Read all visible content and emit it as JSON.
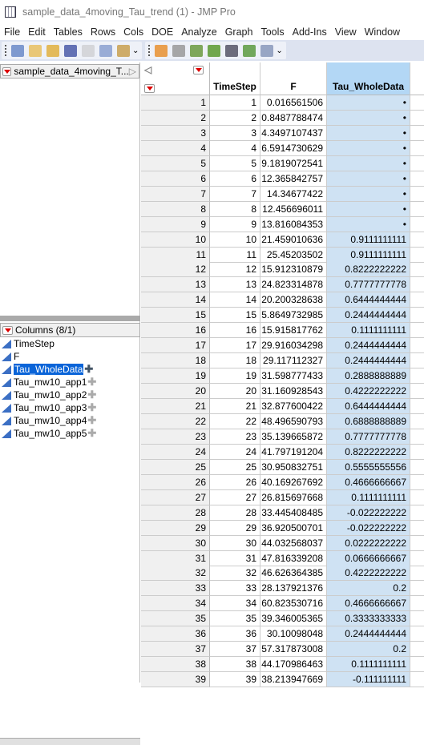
{
  "window": {
    "title": "sample_data_4moving_Tau_trend (1) - JMP Pro"
  },
  "menu": [
    "File",
    "Edit",
    "Tables",
    "Rows",
    "Cols",
    "DOE",
    "Analyze",
    "Graph",
    "Tools",
    "Add-Ins",
    "View",
    "Window"
  ],
  "toolbar": {
    "group1": [
      "new-data-table-icon",
      "new-script-icon",
      "open-icon",
      "save-icon",
      "cut-icon",
      "copy-icon",
      "paste-icon"
    ],
    "group2": [
      "data-table-icon",
      "tabulate-icon",
      "graph-builder-icon",
      "distribution-icon",
      "fit-y-by-x-icon",
      "fit-model-icon",
      "script-editor-icon"
    ]
  },
  "table_panel": {
    "title": "sample_data_4moving_T..."
  },
  "columns_panel": {
    "title": "Columns (8/1)",
    "items": [
      "TimeStep",
      "F",
      "Tau_WholeData",
      "Tau_mw10_app1",
      "Tau_mw10_app2",
      "Tau_mw10_app3",
      "Tau_mw10_app4",
      "Tau_mw10_app5"
    ],
    "selected": "Tau_WholeData"
  },
  "table": {
    "headers": [
      "TimeStep",
      "F",
      "Tau_WholeData"
    ],
    "rows": [
      [
        "1",
        "1",
        "0.016561506",
        "•"
      ],
      [
        "2",
        "2",
        "0.8487788474",
        "•"
      ],
      [
        "3",
        "3",
        "4.3497107437",
        "•"
      ],
      [
        "4",
        "4",
        "6.5914730629",
        "•"
      ],
      [
        "5",
        "5",
        "9.1819072541",
        "•"
      ],
      [
        "6",
        "6",
        "12.365842757",
        "•"
      ],
      [
        "7",
        "7",
        "14.34677422",
        "•"
      ],
      [
        "8",
        "8",
        "12.456696011",
        "•"
      ],
      [
        "9",
        "9",
        "13.816084353",
        "•"
      ],
      [
        "10",
        "10",
        "21.459010636",
        "0.9111111111"
      ],
      [
        "11",
        "11",
        "25.45203502",
        "0.9111111111"
      ],
      [
        "12",
        "12",
        "15.912310879",
        "0.8222222222"
      ],
      [
        "13",
        "13",
        "24.823314878",
        "0.7777777778"
      ],
      [
        "14",
        "14",
        "20.200328638",
        "0.6444444444"
      ],
      [
        "15",
        "15",
        "5.8649732985",
        "0.2444444444"
      ],
      [
        "16",
        "16",
        "15.915817762",
        "0.1111111111"
      ],
      [
        "17",
        "17",
        "29.916034298",
        "0.2444444444"
      ],
      [
        "18",
        "18",
        "29.117112327",
        "0.2444444444"
      ],
      [
        "19",
        "19",
        "31.598777433",
        "0.2888888889"
      ],
      [
        "20",
        "20",
        "31.160928543",
        "0.4222222222"
      ],
      [
        "21",
        "21",
        "32.877600422",
        "0.6444444444"
      ],
      [
        "22",
        "22",
        "48.496590793",
        "0.6888888889"
      ],
      [
        "23",
        "23",
        "35.139665872",
        "0.7777777778"
      ],
      [
        "24",
        "24",
        "41.797191204",
        "0.8222222222"
      ],
      [
        "25",
        "25",
        "30.950832751",
        "0.5555555556"
      ],
      [
        "26",
        "26",
        "40.169267692",
        "0.4666666667"
      ],
      [
        "27",
        "27",
        "26.815697668",
        "0.1111111111"
      ],
      [
        "28",
        "28",
        "33.445408485",
        "-0.022222222"
      ],
      [
        "29",
        "29",
        "36.920500701",
        "-0.022222222"
      ],
      [
        "30",
        "30",
        "44.032568037",
        "0.0222222222"
      ],
      [
        "31",
        "31",
        "47.816339208",
        "0.0666666667"
      ],
      [
        "32",
        "32",
        "46.626364385",
        "0.4222222222"
      ],
      [
        "33",
        "33",
        "28.137921376",
        "0.2"
      ],
      [
        "34",
        "34",
        "60.823530716",
        "0.4666666667"
      ],
      [
        "35",
        "35",
        "39.346005365",
        "0.3333333333"
      ],
      [
        "36",
        "36",
        "30.10098048",
        "0.2444444444"
      ],
      [
        "37",
        "37",
        "57.317873008",
        "0.2"
      ],
      [
        "38",
        "38",
        "44.170986463",
        "0.1111111111"
      ],
      [
        "39",
        "39",
        "38.213947669",
        "-0.111111111"
      ]
    ]
  },
  "colors": {
    "selected_column": "#cfe2f3",
    "selection": "#0a64d8",
    "toolbar": "#dde3f0"
  }
}
